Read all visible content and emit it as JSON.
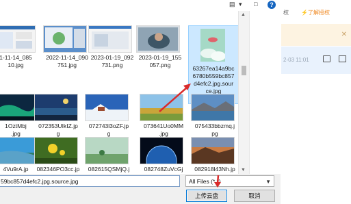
{
  "background_app": {
    "authorize_text": "权",
    "learn_auth_label": "⚡了解授权",
    "notice_close": "✕",
    "row_time": "2-03 11:01"
  },
  "dialog": {
    "help_label": "?",
    "view_icon": "▤",
    "dropdown_icon": "▾",
    "layout_icon": "□",
    "files_row1": [
      {
        "name": "1-11-14_085\n10.jpg",
        "theme": "screenshot"
      },
      {
        "name": "2022-11-14_090\n751.jpg",
        "theme": "desktop"
      },
      {
        "name": "2023-01-19_092\n731.png",
        "theme": "screenshot"
      },
      {
        "name": "2023-01-19_155\n057.png",
        "theme": "portrait"
      }
    ],
    "selected_file": {
      "name": "63267ea14a9bc\n6780b559bc857\nd4efc2.jpg.sour\nce.jpg",
      "theme": "sky"
    },
    "files_row2": [
      {
        "name": "1OztMbj\n.jpg",
        "theme": "aurora"
      },
      {
        "name": "072353UIkIZ.jp\ng",
        "theme": "night"
      },
      {
        "name": "072743l3oZF.jp\ng",
        "theme": "snow"
      },
      {
        "name": "073641Uo0MM\n.jpg",
        "theme": "field"
      },
      {
        "name": "075433bbzmq.j\npg",
        "theme": "lake"
      }
    ],
    "files_row3": [
      {
        "name": "4Vu9rA.jp",
        "theme": "coast"
      },
      {
        "name": "082346PO3cc.jp",
        "theme": "flower"
      },
      {
        "name": "082615QSMjQ.j",
        "theme": "grass"
      },
      {
        "name": "082748ZuVcGj",
        "theme": "earth"
      },
      {
        "name": "082918l43Nh.jp",
        "theme": "sunset"
      }
    ],
    "filename_value": "59bc857d4efc2.jpg.source.jpg",
    "filetype_value": "All Files (*.*)",
    "upload_label": "上传云盘",
    "cancel_label": "取消"
  },
  "colors": {
    "selection": "#cce8ff",
    "accent_blue": "#0078d7",
    "annotation_arrow": "#d92b2b",
    "notice_bg": "#fdf3e1"
  }
}
